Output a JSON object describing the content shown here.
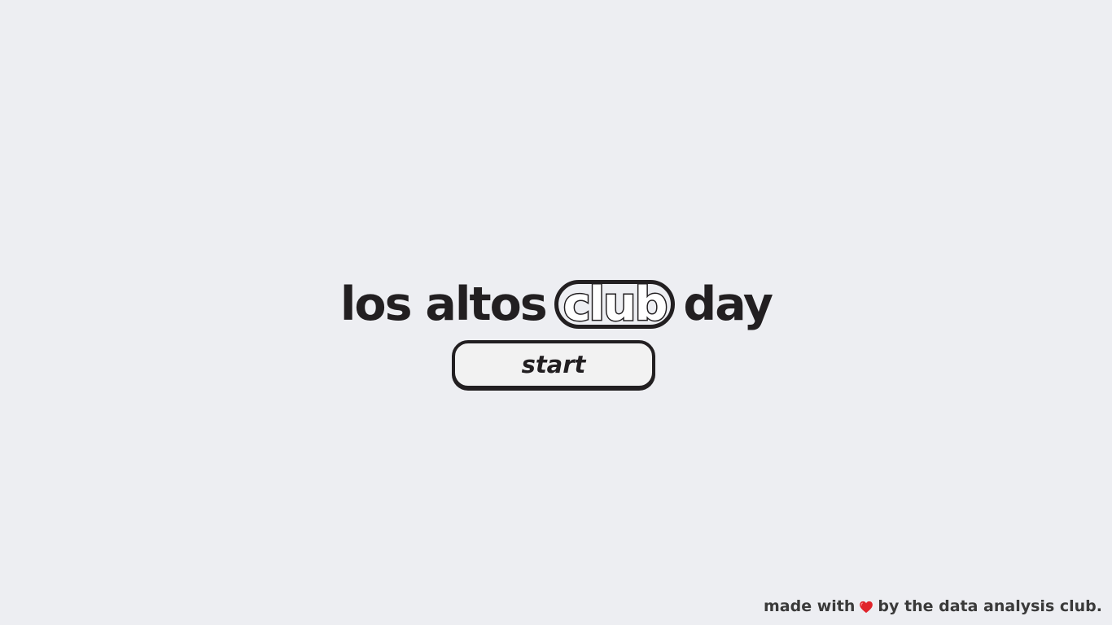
{
  "title": {
    "part1": "los altos",
    "highlight": "club",
    "part2": "day"
  },
  "start_button": {
    "label": "start"
  },
  "footer": {
    "prefix": "made with",
    "icon": "heart-icon",
    "suffix": "by the data analysis club."
  },
  "colors": {
    "background": "#edeef2",
    "text": "#221f21",
    "button_fill": "#f2f2f2",
    "heart": "#e0242b"
  }
}
